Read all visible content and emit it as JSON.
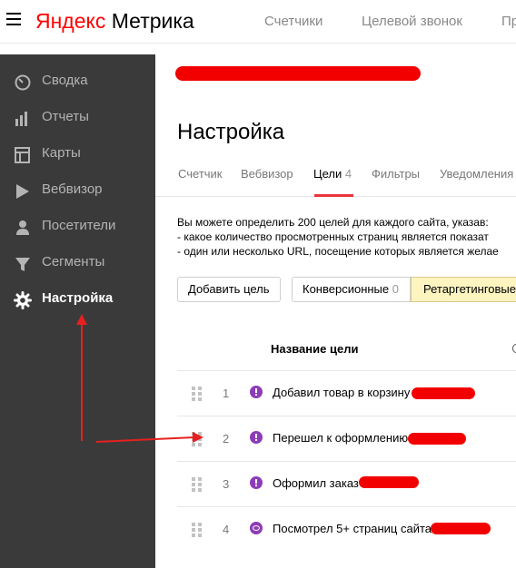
{
  "header": {
    "logo_ya": "Яндекс",
    "logo_metrika": "Метрика",
    "nav": [
      "Счетчики",
      "Целевой звонок",
      "Пр"
    ]
  },
  "sidebar": {
    "items": [
      {
        "label": "Сводка",
        "icon": "gauge-icon"
      },
      {
        "label": "Отчеты",
        "icon": "bar-chart-icon"
      },
      {
        "label": "Карты",
        "icon": "map-icon"
      },
      {
        "label": "Вебвизор",
        "icon": "play-icon"
      },
      {
        "label": "Посетители",
        "icon": "user-icon"
      },
      {
        "label": "Сегменты",
        "icon": "filter-icon"
      },
      {
        "label": "Настройка",
        "icon": "gear-icon",
        "active": true
      }
    ]
  },
  "main": {
    "title": "Настройка",
    "tabs": [
      {
        "label": "Счетчик"
      },
      {
        "label": "Вебвизор"
      },
      {
        "label": "Цели",
        "count": "4",
        "active": true
      },
      {
        "label": "Фильтры"
      },
      {
        "label": "Уведомления"
      }
    ],
    "description": {
      "line1": "Вы можете определить 200 целей для каждого сайта, указав:",
      "line2": "-  какое количество просмотренных страниц является показат",
      "line3": "-  один или несколько URL, посещение которых является желае"
    },
    "add_goal_label": "Добавить цель",
    "filter_conversion": {
      "label": "Конверсионные",
      "count": "0"
    },
    "filter_retargeting": {
      "label": "Ретаргетинговые"
    },
    "column_header": "Название цели",
    "goals": [
      {
        "num": "1",
        "name": "Добавил товар в корзину",
        "icon": "exclamation-icon"
      },
      {
        "num": "2",
        "name": "Перешел к оформлению",
        "icon": "exclamation-icon"
      },
      {
        "num": "3",
        "name": "Оформил заказ",
        "icon": "exclamation-icon"
      },
      {
        "num": "4",
        "name": "Посмотрел 5+ страниц сайта",
        "icon": "eye-icon"
      }
    ]
  },
  "colors": {
    "accent_red": "#e8353b",
    "sidebar_bg": "#3a3a3a",
    "goal_icon": "#8d3cb8",
    "retargeting_bg": "#fdf4c0",
    "annotation_red": "#e62020"
  }
}
